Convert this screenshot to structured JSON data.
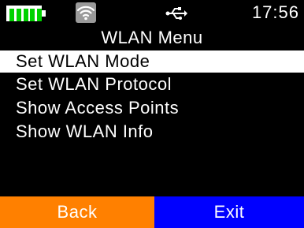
{
  "status_bar": {
    "battery_icon": "battery-icon",
    "battery_level": 1.0,
    "battery_color": "#00d200",
    "wifi_icon": "wifi-icon",
    "usb_icon": "usb-icon",
    "time": "17:56"
  },
  "menu": {
    "title": "WLAN Menu",
    "items": [
      {
        "label": "Set WLAN Mode",
        "selected": true
      },
      {
        "label": "Set WLAN Protocol",
        "selected": false
      },
      {
        "label": "Show Access Points",
        "selected": false
      },
      {
        "label": "Show WLAN Info",
        "selected": false
      }
    ]
  },
  "softkeys": {
    "back_label": "Back",
    "back_color": "#ff8000",
    "exit_label": "Exit",
    "exit_color": "#0000ff"
  },
  "colors": {
    "background": "#000000",
    "text": "#ffffff",
    "selection_bg": "#ffffff",
    "selection_text": "#000000"
  }
}
